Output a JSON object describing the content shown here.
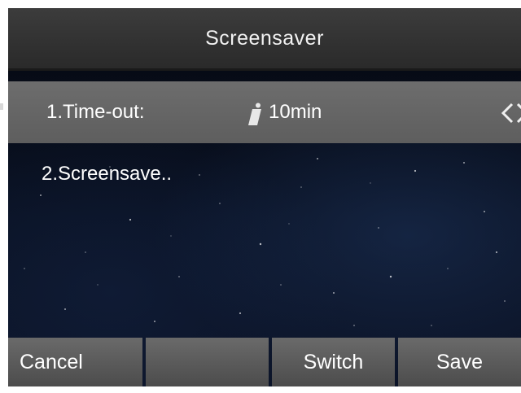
{
  "title": "Screensaver",
  "menu": {
    "items": [
      {
        "label": "1.Time-out:",
        "value": "10min"
      },
      {
        "label": "2.Screensave.."
      }
    ]
  },
  "softkeys": [
    "Cancel",
    "",
    "Switch",
    "Save"
  ],
  "icons": {
    "info": "info-icon",
    "left_arrow": "chevron-left-icon",
    "right_arrow": "chevron-right-icon"
  },
  "colors": {
    "title_bar": "#333333",
    "selected_row": "#666666",
    "softkey": "#5a5a5a",
    "background": "#07101f",
    "text": "#ffffff"
  }
}
